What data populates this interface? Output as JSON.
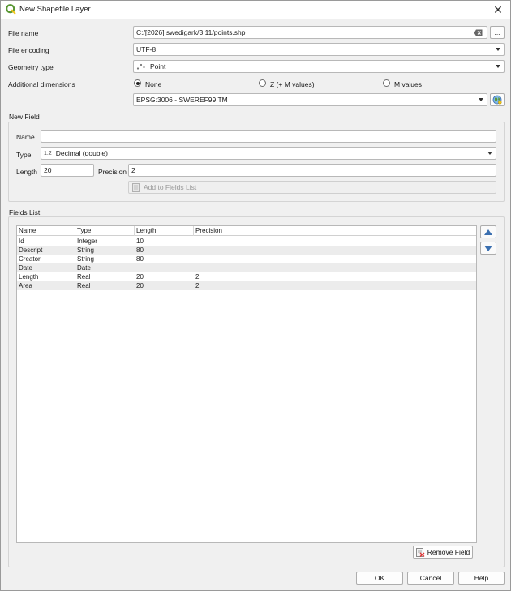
{
  "window": {
    "title": "New Shapefile Layer",
    "close_glyph": "✕"
  },
  "form": {
    "file_name_label": "File name",
    "file_name_value": "C:/[2026] swedigark/3.11/points.shp",
    "browse_label": "...",
    "file_encoding_label": "File encoding",
    "file_encoding_value": "UTF-8",
    "geometry_type_label": "Geometry type",
    "geometry_type_value": "Point",
    "additional_dimensions_label": "Additional dimensions",
    "dim_none": "None",
    "dim_z": "Z (+ M values)",
    "dim_m": "M values",
    "crs_value": "EPSG:3006 - SWEREF99 TM"
  },
  "new_field": {
    "title": "New Field",
    "name_label": "Name",
    "name_value": "",
    "type_label": "Type",
    "type_prefix": "1.2",
    "type_value": "Decimal (double)",
    "length_label": "Length",
    "length_value": "20",
    "precision_label": "Precision",
    "precision_value": "2",
    "add_button": "Add to Fields List"
  },
  "fields_list": {
    "title": "Fields List",
    "columns": [
      "Name",
      "Type",
      "Length",
      "Precision"
    ],
    "rows": [
      [
        "Id",
        "Integer",
        "10",
        ""
      ],
      [
        "Descript",
        "String",
        "80",
        ""
      ],
      [
        "Creator",
        "String",
        "80",
        ""
      ],
      [
        "Date",
        "Date",
        "",
        ""
      ],
      [
        "Length",
        "Real",
        "20",
        "2"
      ],
      [
        "Area",
        "Real",
        "20",
        "2"
      ]
    ],
    "remove_button": "Remove Field"
  },
  "footer": {
    "ok": "OK",
    "cancel": "Cancel",
    "help": "Help"
  },
  "colors": {
    "accent": "#3a6fb0",
    "qgis_green": "#589632",
    "qgis_yellow": "#f0c419"
  }
}
